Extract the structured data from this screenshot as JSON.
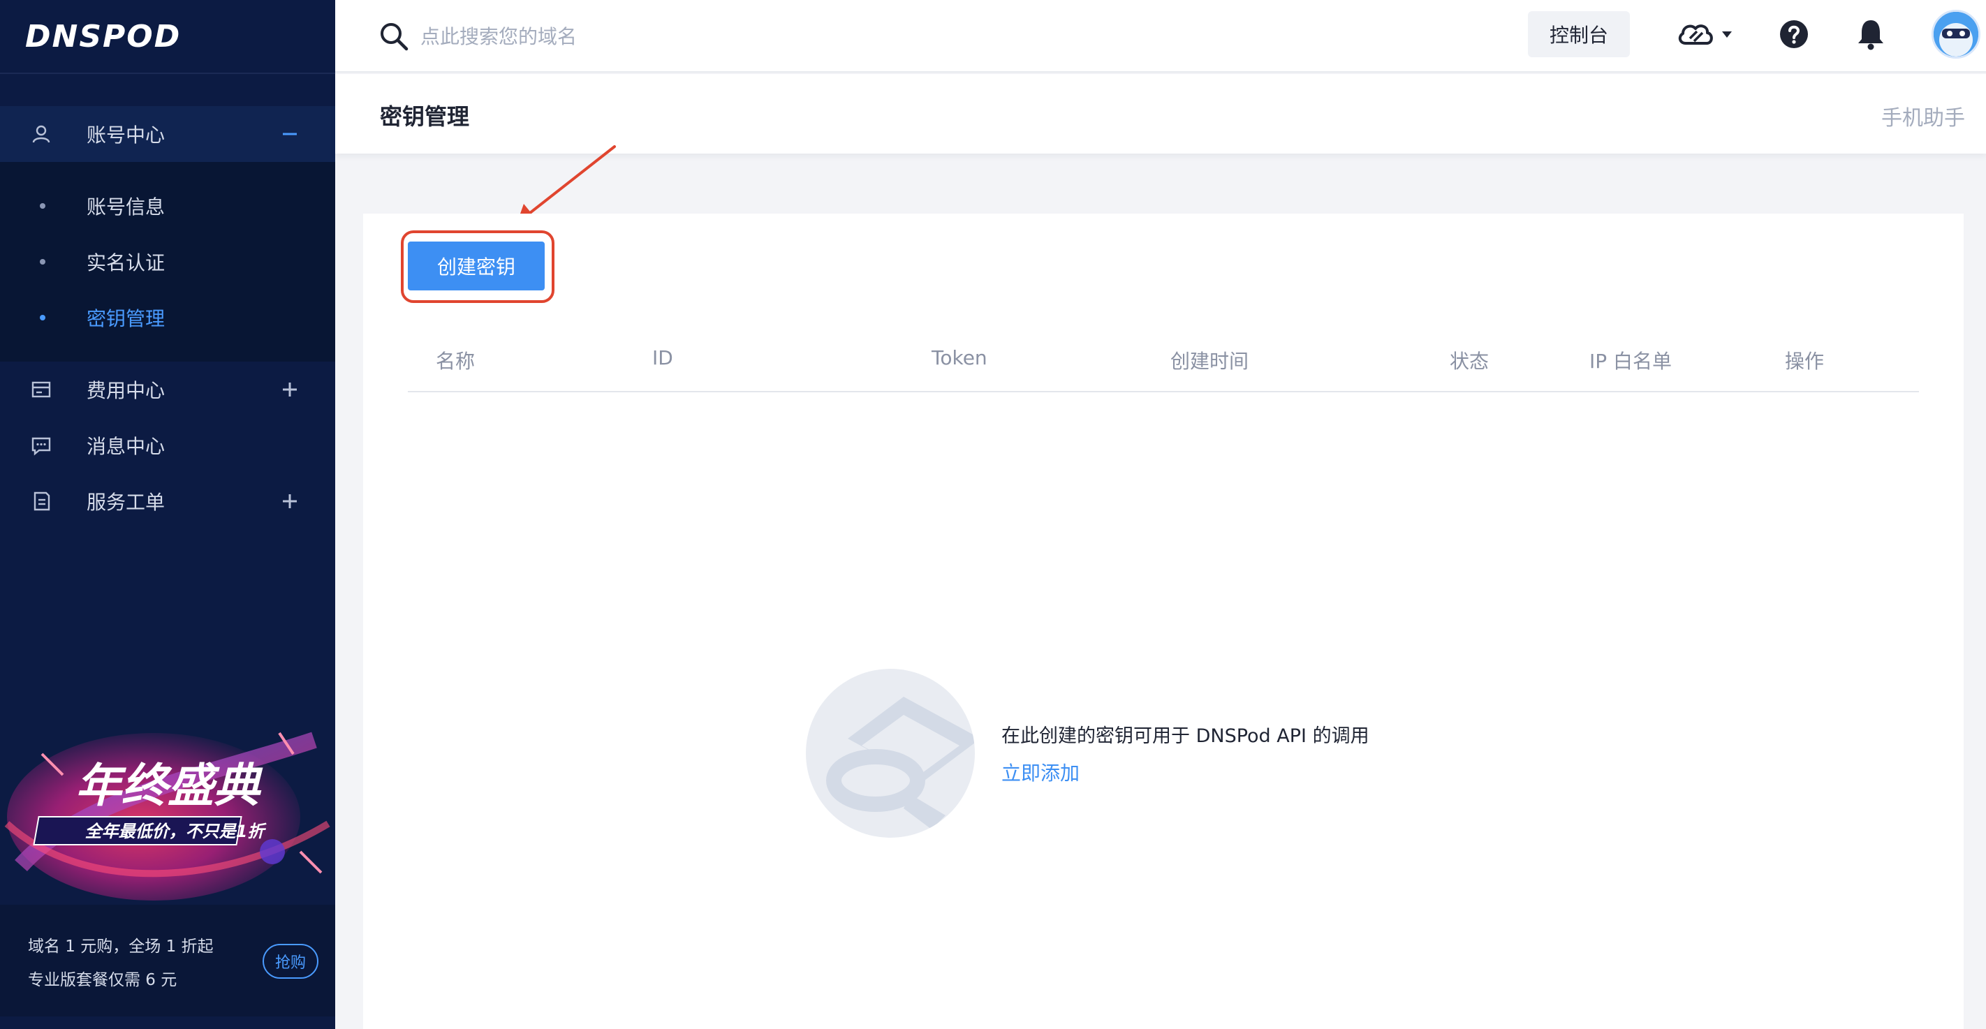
{
  "brand": {
    "logo_text": "DNSPOD"
  },
  "search": {
    "placeholder": "点此搜索您的域名"
  },
  "topbar": {
    "console_label": "控制台"
  },
  "sidebar": {
    "groups": [
      {
        "label": "账号中心",
        "icon": "user-icon",
        "toggle": "minus-icon",
        "expanded": true
      },
      {
        "label": "费用中心",
        "icon": "wallet-icon",
        "toggle": "plus-icon",
        "expanded": false
      },
      {
        "label": "消息中心",
        "icon": "message-icon",
        "toggle": "",
        "expanded": false
      },
      {
        "label": "服务工单",
        "icon": "ticket-icon",
        "toggle": "plus-icon",
        "expanded": false
      }
    ],
    "sub_items": [
      {
        "label": "账号信息",
        "active": false
      },
      {
        "label": "实名认证",
        "active": false
      },
      {
        "label": "密钥管理",
        "active": true
      }
    ]
  },
  "promo": {
    "banner_title": "年终盛典",
    "banner_subtitle": "全年最低价，不只是1折",
    "line1": "域名 1 元购，全场 1 折起",
    "line2": "专业版套餐仅需 6 元",
    "button_label": "抢购"
  },
  "page": {
    "title": "密钥管理",
    "mobile_link": "手机助手"
  },
  "main": {
    "create_button": "创建密钥",
    "columns": [
      "名称",
      "ID",
      "Token",
      "创建时间",
      "状态",
      "IP 白名单",
      "操作"
    ],
    "empty_text": "在此创建的密钥可用于 DNSPod API 的调用",
    "empty_link": "立即添加"
  },
  "colors": {
    "sidebar_bg": "#0c1b43",
    "accent": "#3d8ff3",
    "annotation": "#e0452f"
  }
}
